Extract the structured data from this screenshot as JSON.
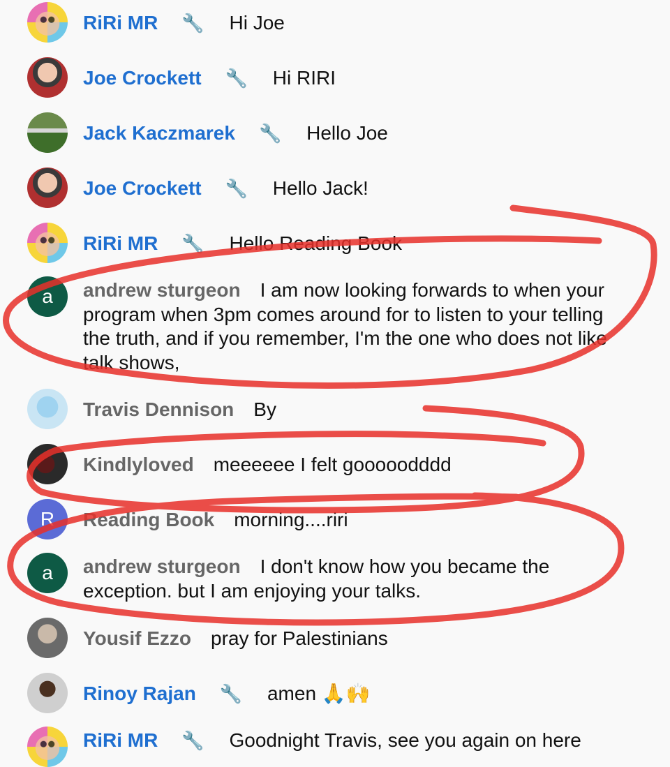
{
  "messages": [
    {
      "name": "RiRi MR",
      "moderator": true,
      "text": "Hi Joe",
      "avatar": "riri-avatar",
      "avatar_letter": ""
    },
    {
      "name": "Joe Crockett",
      "moderator": true,
      "text": "Hi RIRI",
      "avatar": "joe-avatar",
      "avatar_letter": ""
    },
    {
      "name": "Jack Kaczmarek",
      "moderator": true,
      "text": "Hello Joe",
      "avatar": "jack-avatar",
      "avatar_letter": ""
    },
    {
      "name": "Joe Crockett",
      "moderator": true,
      "text": "Hello Jack!",
      "avatar": "joe-avatar",
      "avatar_letter": ""
    },
    {
      "name": "RiRi MR",
      "moderator": true,
      "text": "Hello Reading Book",
      "avatar": "riri-avatar",
      "avatar_letter": ""
    },
    {
      "name": "andrew sturgeon",
      "moderator": false,
      "text": "I am now looking forwards to when your program when 3pm comes around for to listen to your telling the truth, and if you remember, I'm the one who does not like talk shows,",
      "avatar": "letter-avatar",
      "avatar_letter": "a"
    },
    {
      "name": "Travis Dennison",
      "moderator": false,
      "text": "By",
      "avatar": "travis-avatar",
      "avatar_letter": ""
    },
    {
      "name": "Kindlyloved",
      "moderator": false,
      "text": "meeeeee I felt gooooodddd",
      "avatar": "kindly-avatar",
      "avatar_letter": ""
    },
    {
      "name": "Reading Book",
      "moderator": false,
      "text": "morning....riri",
      "avatar": "letter-avatar",
      "avatar_letter": "R"
    },
    {
      "name": "andrew sturgeon",
      "moderator": false,
      "text": "I don't know how you became the exception. but I am enjoying your talks.",
      "avatar": "letter-avatar",
      "avatar_letter": "a"
    },
    {
      "name": "Yousif Ezzo",
      "moderator": false,
      "text": "pray for Palestinians",
      "avatar": "yousif-avatar",
      "avatar_letter": ""
    },
    {
      "name": "Rinoy Rajan",
      "moderator": true,
      "text": "amen 🙏🙌",
      "avatar": "rinoy-avatar",
      "avatar_letter": ""
    },
    {
      "name": "RiRi MR",
      "moderator": true,
      "text": "Goodnight Travis, see you again on here",
      "avatar": "riri-avatar",
      "avatar_letter": ""
    }
  ],
  "icons": {
    "moderator": "wrench-icon"
  },
  "colors": {
    "host_name": "#1f6fd0",
    "viewer_name": "#666666",
    "scribble": "#e8302a",
    "wrench": "#3b82f6"
  }
}
